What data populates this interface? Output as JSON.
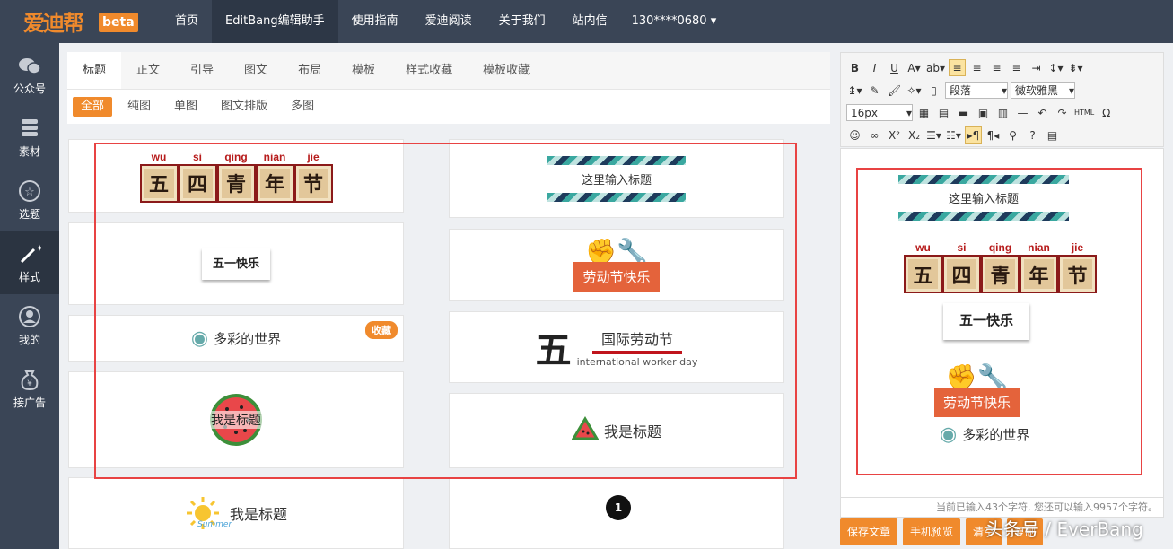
{
  "brand": {
    "logo": "爱迪帮",
    "beta": "beta"
  },
  "topnav": [
    "首页",
    "EditBang编辑助手",
    "使用指南",
    "爱迪阅读",
    "关于我们",
    "站内信"
  ],
  "user": "130****0680",
  "sidebar": [
    {
      "label": "公众号",
      "icon": "wechat-icon"
    },
    {
      "label": "素材",
      "icon": "material-icon"
    },
    {
      "label": "选题",
      "icon": "star-icon"
    },
    {
      "label": "样式",
      "icon": "magic-wand-icon"
    },
    {
      "label": "我的",
      "icon": "user-icon"
    },
    {
      "label": "接广告",
      "icon": "money-bag-icon"
    }
  ],
  "tabs": [
    "标题",
    "正文",
    "引导",
    "图文",
    "布局",
    "模板",
    "样式收藏",
    "模板收藏"
  ],
  "subtabs": [
    "全部",
    "纯图",
    "单图",
    "图文排版",
    "多图"
  ],
  "templates": {
    "youth_day": {
      "pinyin": [
        "wu",
        "si",
        "qing",
        "nian",
        "jie"
      ],
      "chars": [
        "五",
        "四",
        "青",
        "年",
        "节"
      ]
    },
    "input_title": "这里输入标题",
    "may_day": "五一快乐",
    "labor_day": "劳动节快乐",
    "colorful": "多彩的世界",
    "fav": "收藏",
    "intl": {
      "big": "五",
      "cn": "国际劳动节",
      "en": "international worker day"
    },
    "my_title_1": "我是标题",
    "my_title_2": "我是标题",
    "my_title_3": "我是标题",
    "summer": "Summer"
  },
  "pager": "1",
  "toolbar": {
    "paragraph": "段落",
    "font": "微软雅黑",
    "size": "16px"
  },
  "counter": "当前已输入43个字符, 您还可以输入9957个字符。",
  "actions": [
    "保存文章",
    "手机预览",
    "清空",
    "复制"
  ],
  "watermark": "头条号 / EverBang"
}
